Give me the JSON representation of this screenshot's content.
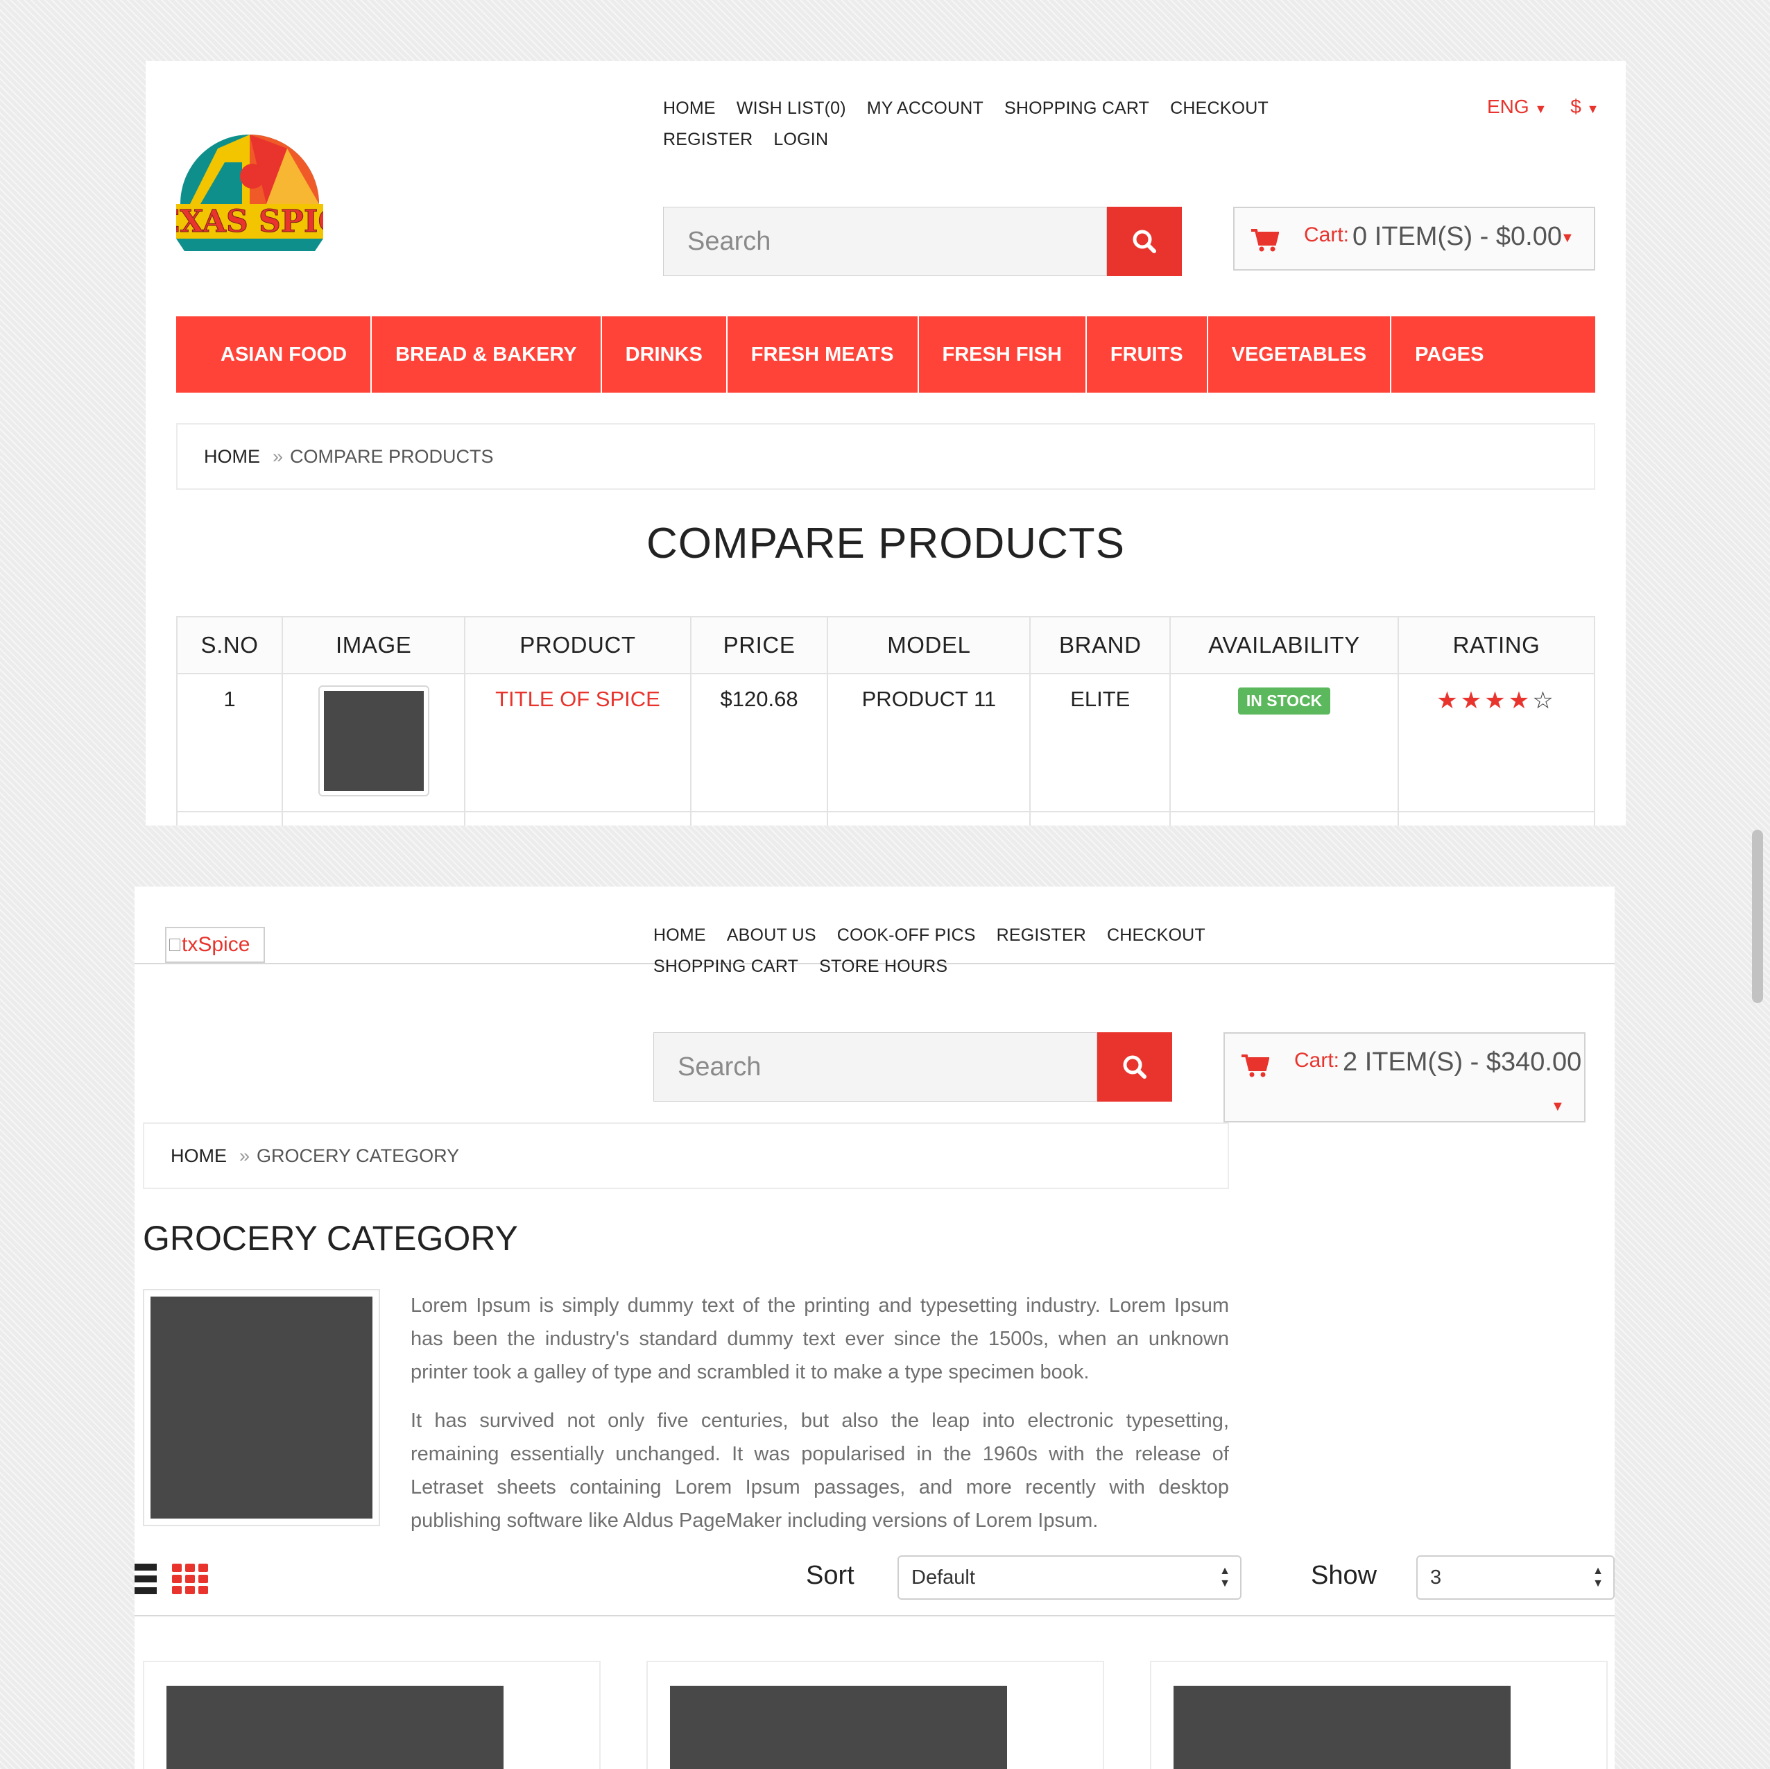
{
  "top": {
    "logo_alt": "Texas Spice",
    "nav": [
      "HOME",
      "WISH LIST(0)",
      "MY ACCOUNT",
      "SHOPPING CART",
      "CHECKOUT",
      "REGISTER",
      "LOGIN"
    ],
    "language": "ENG",
    "currency": "$",
    "search_placeholder": "Search",
    "cart_label": "Cart:",
    "cart_value": "0 ITEM(S) - $0.00",
    "categories": [
      "ASIAN FOOD",
      "BREAD & BAKERY",
      "DRINKS",
      "FRESH MEATS",
      "FRESH FISH",
      "FRUITS",
      "VEGETABLES",
      "PAGES"
    ],
    "breadcrumb": {
      "home": "HOME",
      "sep": "»",
      "current": "COMPARE PRODUCTS"
    },
    "title": "COMPARE PRODUCTS",
    "table": {
      "headers": [
        "S.NO",
        "IMAGE",
        "PRODUCT",
        "PRICE",
        "MODEL",
        "BRAND",
        "AVAILABILITY",
        "RATING"
      ],
      "row": {
        "sno": "1",
        "product": "TITLE OF SPICE",
        "price": "$120.68",
        "model": "PRODUCT 11",
        "brand": "ELITE",
        "availability": "IN STOCK",
        "rating": 4,
        "rating_max": 5
      }
    }
  },
  "bottom": {
    "logo_alt": "txSpice",
    "nav": [
      "HOME",
      "ABOUT US",
      "COOK-OFF PICS",
      "REGISTER",
      "CHECKOUT",
      "SHOPPING CART",
      "STORE HOURS"
    ],
    "search_placeholder": "Search",
    "cart_label": "Cart:",
    "cart_value": "2 ITEM(S) - $340.00",
    "breadcrumb": {
      "home": "HOME",
      "sep": "»",
      "current": "GROCERY CATEGORY"
    },
    "title": "GROCERY CATEGORY",
    "description": [
      "Lorem Ipsum is simply dummy text of the printing and typesetting industry. Lorem Ipsum has been the industry's standard dummy text ever since the 1500s, when an unknown printer took a galley of type and scrambled it to make a type specimen book.",
      "It has survived not only five centuries, but also the leap into electronic typesetting, remaining essentially unchanged. It was popularised in the 1960s with the release of Letraset sheets containing Lorem Ipsum passages, and more recently with desktop publishing software like Aldus PageMaker including versions of Lorem Ipsum."
    ],
    "sort_label": "Sort",
    "sort_value": "Default",
    "show_label": "Show",
    "show_value": "3"
  },
  "colors": {
    "accent": "#e8342d",
    "nav_bar": "#ff4338",
    "in_stock": "#5cb85c",
    "placeholder": "#484848"
  }
}
